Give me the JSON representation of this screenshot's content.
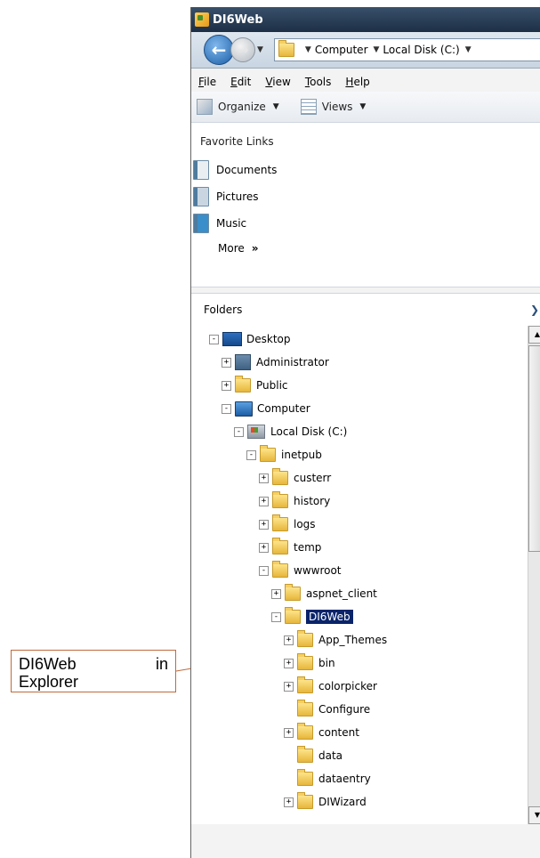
{
  "window": {
    "title": "DI6Web"
  },
  "navigation": {
    "breadcrumb": [
      "Computer",
      "Local Disk (C:)"
    ]
  },
  "menubar": [
    "File",
    "Edit",
    "View",
    "Tools",
    "Help"
  ],
  "toolbar": {
    "organize_label": "Organize",
    "views_label": "Views"
  },
  "favorites": {
    "title": "Favorite Links",
    "items": [
      "Documents",
      "Pictures",
      "Music"
    ],
    "more_label": "More",
    "more_arrow": "»"
  },
  "folders": {
    "title": "Folders",
    "tree": [
      {
        "label": "Desktop",
        "icon": "desktop-icon",
        "expander": "minus",
        "selected": false
      },
      {
        "label": "Administrator",
        "icon": "user-folder-icon",
        "expander": "plus",
        "selected": false
      },
      {
        "label": "Public",
        "icon": "folder-icon",
        "expander": "plus",
        "selected": false
      },
      {
        "label": "Computer",
        "icon": "computer-icon",
        "expander": "minus",
        "selected": false
      },
      {
        "label": "Local Disk (C:)",
        "icon": "disk-icon",
        "expander": "minus",
        "selected": false
      },
      {
        "label": "inetpub",
        "icon": "folder-icon",
        "expander": "minus",
        "selected": false
      },
      {
        "label": "custerr",
        "icon": "folder-icon",
        "expander": "plus",
        "selected": false
      },
      {
        "label": "history",
        "icon": "folder-icon",
        "expander": "plus",
        "selected": false
      },
      {
        "label": "logs",
        "icon": "folder-icon",
        "expander": "plus",
        "selected": false
      },
      {
        "label": "temp",
        "icon": "folder-icon",
        "expander": "plus",
        "selected": false
      },
      {
        "label": "wwwroot",
        "icon": "folder-icon",
        "expander": "minus",
        "selected": false
      },
      {
        "label": "aspnet_client",
        "icon": "folder-icon",
        "expander": "plus",
        "selected": false
      },
      {
        "label": "DI6Web",
        "icon": "folder-icon",
        "expander": "minus",
        "selected": true
      },
      {
        "label": "App_Themes",
        "icon": "folder-icon",
        "expander": "plus",
        "selected": false
      },
      {
        "label": "bin",
        "icon": "folder-icon",
        "expander": "plus",
        "selected": false
      },
      {
        "label": "colorpicker",
        "icon": "folder-icon",
        "expander": "plus",
        "selected": false
      },
      {
        "label": "Configure",
        "icon": "folder-icon",
        "expander": "none",
        "selected": false
      },
      {
        "label": "content",
        "icon": "folder-icon",
        "expander": "plus",
        "selected": false
      },
      {
        "label": "data",
        "icon": "folder-icon",
        "expander": "none",
        "selected": false
      },
      {
        "label": "dataentry",
        "icon": "folder-icon",
        "expander": "none",
        "selected": false
      },
      {
        "label": "DIWizard",
        "icon": "folder-icon",
        "expander": "plus",
        "selected": false
      }
    ]
  },
  "callout": {
    "line1_word1": "DI6Web",
    "line1_word2": "in",
    "line2": "Explorer"
  },
  "colors": {
    "selection": "#0a246a",
    "callout_border": "#c06a3c",
    "titlebar": "#1c2f45"
  }
}
